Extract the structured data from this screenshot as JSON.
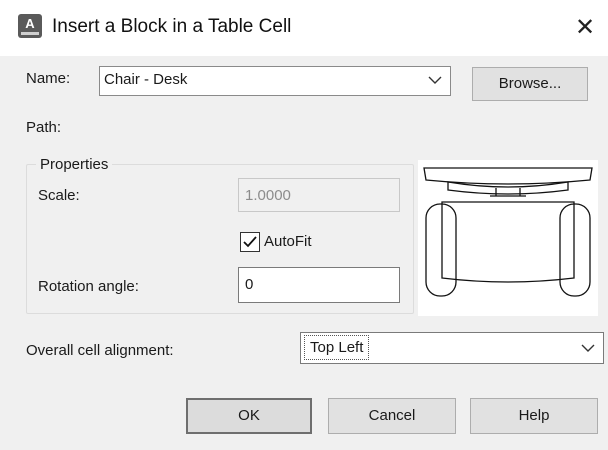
{
  "dialog": {
    "title": "Insert a Block in a Table Cell",
    "icon": "autocad-app-icon",
    "icon_glyph": "A",
    "close_glyph": "✕"
  },
  "name": {
    "label": "Name:",
    "value": "Chair - Desk",
    "browse_label": "Browse..."
  },
  "path": {
    "label": "Path:"
  },
  "properties": {
    "title": "Properties",
    "scale_label": "Scale:",
    "scale_value": "1.0000",
    "scale_enabled": false,
    "autofit_label": "AutoFit",
    "autofit_checked": true,
    "rotation_label": "Rotation angle:",
    "rotation_value": "0"
  },
  "preview": {
    "icon": "chair-desk-block-preview"
  },
  "alignment": {
    "label": "Overall cell alignment:",
    "value": "Top Left"
  },
  "buttons": {
    "ok": "OK",
    "cancel": "Cancel",
    "help": "Help"
  }
}
